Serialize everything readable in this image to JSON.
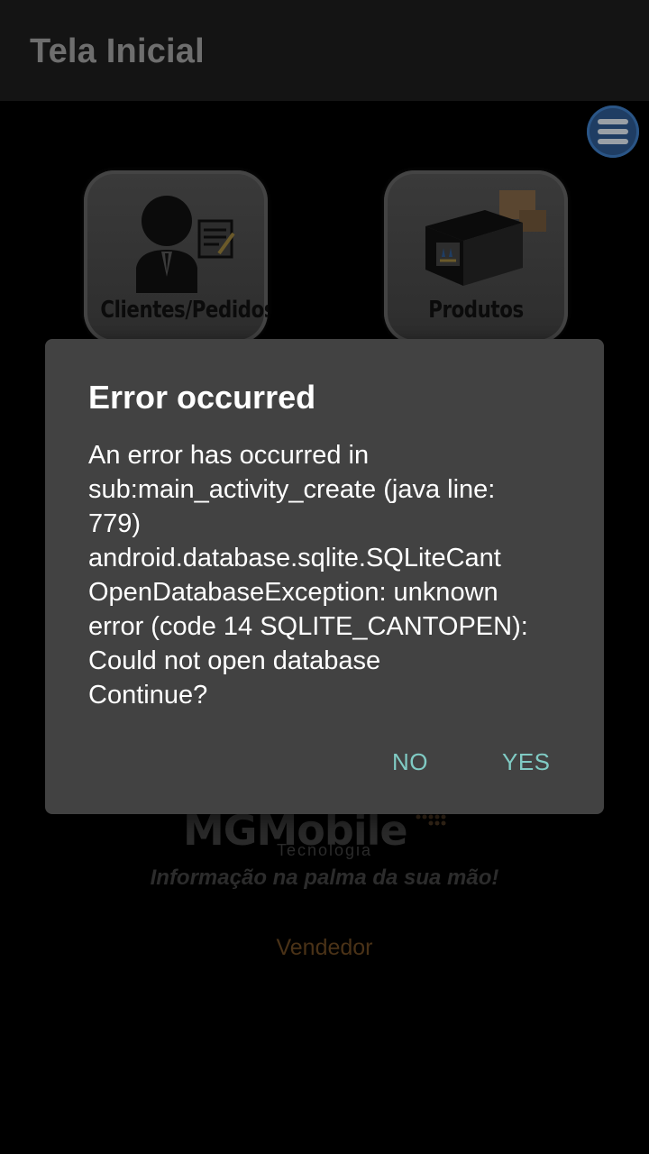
{
  "appbar": {
    "title": "Tela Inicial"
  },
  "menu": {
    "icon": "menu-icon"
  },
  "tiles": [
    {
      "label": "Clientes/Pedidos",
      "icon": "salesman-icon"
    },
    {
      "label": "Produtos",
      "icon": "boxes-icon"
    }
  ],
  "branding": {
    "logo_text": "MGMobile",
    "logo_sub": "Tecnologia",
    "tagline": "Informação na palma da sua mão!",
    "role": "Vendedor"
  },
  "dialog": {
    "title": "Error occurred",
    "message": "An error has occurred in\nsub:main_activity_create (java line:\n779)\nandroid.database.sqlite.SQLiteCant\nOpenDatabaseException: unknown\nerror (code 14 SQLITE_CANTOPEN):\nCould not open database\nContinue?",
    "no_label": "NO",
    "yes_label": "YES"
  },
  "colors": {
    "accent": "#80cbc4",
    "dialog_bg": "#424242",
    "role_text": "#4a3217"
  }
}
